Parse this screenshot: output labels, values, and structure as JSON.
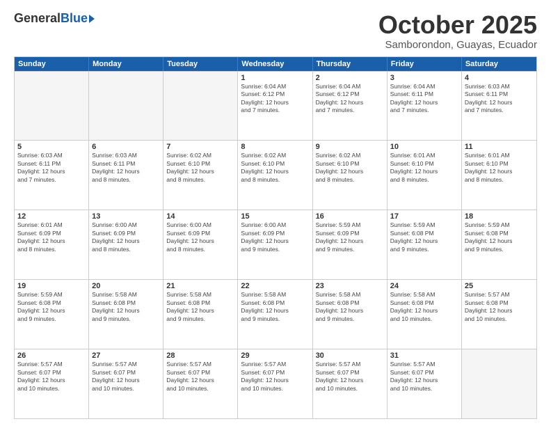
{
  "header": {
    "logo_general": "General",
    "logo_blue": "Blue",
    "title": "October 2025",
    "subtitle": "Samborondon, Guayas, Ecuador"
  },
  "calendar": {
    "days_of_week": [
      "Sunday",
      "Monday",
      "Tuesday",
      "Wednesday",
      "Thursday",
      "Friday",
      "Saturday"
    ],
    "weeks": [
      [
        {
          "day": "",
          "info": ""
        },
        {
          "day": "",
          "info": ""
        },
        {
          "day": "",
          "info": ""
        },
        {
          "day": "1",
          "info": "Sunrise: 6:04 AM\nSunset: 6:12 PM\nDaylight: 12 hours\nand 7 minutes."
        },
        {
          "day": "2",
          "info": "Sunrise: 6:04 AM\nSunset: 6:12 PM\nDaylight: 12 hours\nand 7 minutes."
        },
        {
          "day": "3",
          "info": "Sunrise: 6:04 AM\nSunset: 6:11 PM\nDaylight: 12 hours\nand 7 minutes."
        },
        {
          "day": "4",
          "info": "Sunrise: 6:03 AM\nSunset: 6:11 PM\nDaylight: 12 hours\nand 7 minutes."
        }
      ],
      [
        {
          "day": "5",
          "info": "Sunrise: 6:03 AM\nSunset: 6:11 PM\nDaylight: 12 hours\nand 7 minutes."
        },
        {
          "day": "6",
          "info": "Sunrise: 6:03 AM\nSunset: 6:11 PM\nDaylight: 12 hours\nand 8 minutes."
        },
        {
          "day": "7",
          "info": "Sunrise: 6:02 AM\nSunset: 6:10 PM\nDaylight: 12 hours\nand 8 minutes."
        },
        {
          "day": "8",
          "info": "Sunrise: 6:02 AM\nSunset: 6:10 PM\nDaylight: 12 hours\nand 8 minutes."
        },
        {
          "day": "9",
          "info": "Sunrise: 6:02 AM\nSunset: 6:10 PM\nDaylight: 12 hours\nand 8 minutes."
        },
        {
          "day": "10",
          "info": "Sunrise: 6:01 AM\nSunset: 6:10 PM\nDaylight: 12 hours\nand 8 minutes."
        },
        {
          "day": "11",
          "info": "Sunrise: 6:01 AM\nSunset: 6:10 PM\nDaylight: 12 hours\nand 8 minutes."
        }
      ],
      [
        {
          "day": "12",
          "info": "Sunrise: 6:01 AM\nSunset: 6:09 PM\nDaylight: 12 hours\nand 8 minutes."
        },
        {
          "day": "13",
          "info": "Sunrise: 6:00 AM\nSunset: 6:09 PM\nDaylight: 12 hours\nand 8 minutes."
        },
        {
          "day": "14",
          "info": "Sunrise: 6:00 AM\nSunset: 6:09 PM\nDaylight: 12 hours\nand 8 minutes."
        },
        {
          "day": "15",
          "info": "Sunrise: 6:00 AM\nSunset: 6:09 PM\nDaylight: 12 hours\nand 9 minutes."
        },
        {
          "day": "16",
          "info": "Sunrise: 5:59 AM\nSunset: 6:09 PM\nDaylight: 12 hours\nand 9 minutes."
        },
        {
          "day": "17",
          "info": "Sunrise: 5:59 AM\nSunset: 6:08 PM\nDaylight: 12 hours\nand 9 minutes."
        },
        {
          "day": "18",
          "info": "Sunrise: 5:59 AM\nSunset: 6:08 PM\nDaylight: 12 hours\nand 9 minutes."
        }
      ],
      [
        {
          "day": "19",
          "info": "Sunrise: 5:59 AM\nSunset: 6:08 PM\nDaylight: 12 hours\nand 9 minutes."
        },
        {
          "day": "20",
          "info": "Sunrise: 5:58 AM\nSunset: 6:08 PM\nDaylight: 12 hours\nand 9 minutes."
        },
        {
          "day": "21",
          "info": "Sunrise: 5:58 AM\nSunset: 6:08 PM\nDaylight: 12 hours\nand 9 minutes."
        },
        {
          "day": "22",
          "info": "Sunrise: 5:58 AM\nSunset: 6:08 PM\nDaylight: 12 hours\nand 9 minutes."
        },
        {
          "day": "23",
          "info": "Sunrise: 5:58 AM\nSunset: 6:08 PM\nDaylight: 12 hours\nand 9 minutes."
        },
        {
          "day": "24",
          "info": "Sunrise: 5:58 AM\nSunset: 6:08 PM\nDaylight: 12 hours\nand 10 minutes."
        },
        {
          "day": "25",
          "info": "Sunrise: 5:57 AM\nSunset: 6:08 PM\nDaylight: 12 hours\nand 10 minutes."
        }
      ],
      [
        {
          "day": "26",
          "info": "Sunrise: 5:57 AM\nSunset: 6:07 PM\nDaylight: 12 hours\nand 10 minutes."
        },
        {
          "day": "27",
          "info": "Sunrise: 5:57 AM\nSunset: 6:07 PM\nDaylight: 12 hours\nand 10 minutes."
        },
        {
          "day": "28",
          "info": "Sunrise: 5:57 AM\nSunset: 6:07 PM\nDaylight: 12 hours\nand 10 minutes."
        },
        {
          "day": "29",
          "info": "Sunrise: 5:57 AM\nSunset: 6:07 PM\nDaylight: 12 hours\nand 10 minutes."
        },
        {
          "day": "30",
          "info": "Sunrise: 5:57 AM\nSunset: 6:07 PM\nDaylight: 12 hours\nand 10 minutes."
        },
        {
          "day": "31",
          "info": "Sunrise: 5:57 AM\nSunset: 6:07 PM\nDaylight: 12 hours\nand 10 minutes."
        },
        {
          "day": "",
          "info": ""
        }
      ]
    ]
  }
}
